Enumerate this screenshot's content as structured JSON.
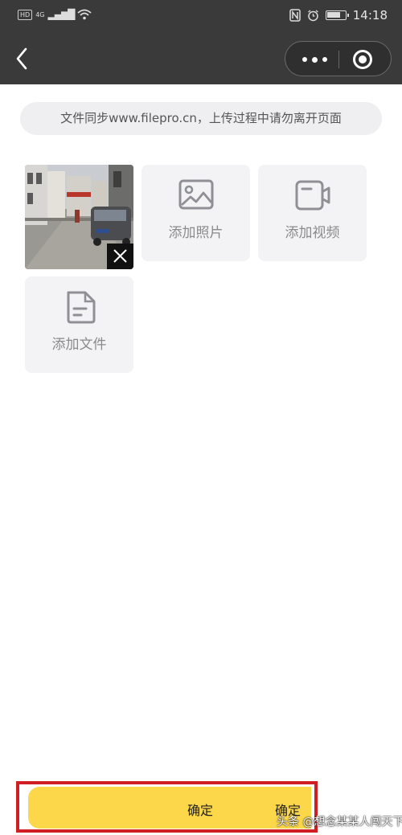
{
  "status_bar": {
    "hd": "HD",
    "network": "4G",
    "time": "14:18"
  },
  "notice": {
    "text": "文件同步www.filepro.cn，上传过程中请勿离开页面"
  },
  "tiles": {
    "add_photo": "添加照片",
    "add_video": "添加视频",
    "add_file": "添加文件"
  },
  "confirm": {
    "label_1": "确定",
    "label_2": "确定"
  },
  "watermark": "头条 @想念某某人闯天下",
  "colors": {
    "confirm_bg": "#fcd74a",
    "highlight_border": "#d01f24",
    "topbar": "#3a3a3a"
  }
}
